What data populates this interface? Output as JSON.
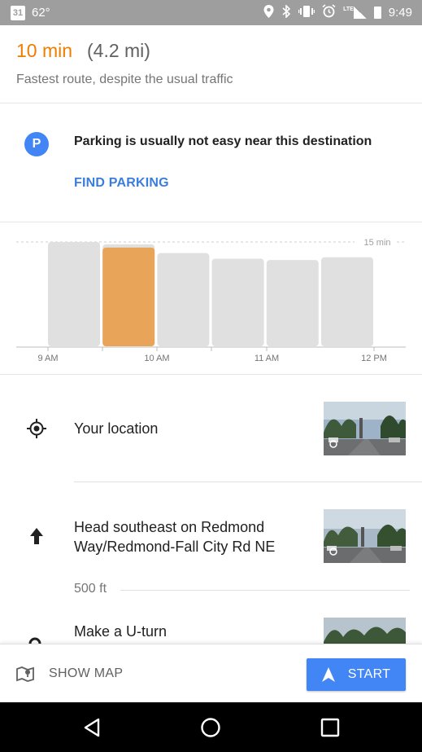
{
  "status_bar": {
    "calendar_day": "31",
    "temperature": "62°",
    "network": "LTE",
    "clock": "9:49",
    "icons": [
      "calendar-icon",
      "location-icon",
      "bluetooth-icon",
      "vibrate-icon",
      "alarm-icon",
      "signal-icon",
      "battery-icon"
    ]
  },
  "route": {
    "duration": "10 min",
    "distance": "(4.2 mi)",
    "summary": "Fastest route, despite the usual traffic"
  },
  "parking": {
    "icon_letter": "P",
    "message": "Parking is usually not easy near this destination",
    "action": "FIND PARKING"
  },
  "chart_data": {
    "type": "bar",
    "categories": [
      "9:00",
      "9:30",
      "10:00",
      "10:30",
      "11:00",
      "11:30"
    ],
    "values": [
      15,
      14.2,
      13.4,
      12.6,
      12.4,
      12.8
    ],
    "highlighted_index": 1,
    "highlight_color": "#e8a55a",
    "bar_color": "#e0e0e0",
    "reference_line_label": "15 min",
    "x_tick_labels": [
      "9 AM",
      "10 AM",
      "11 AM",
      "12 PM"
    ],
    "grid": false
  },
  "steps": {
    "origin": "Your location",
    "step1_text": "Head southeast on Redmond Way/Redmond-Fall City Rd NE",
    "step1_distance": "500 ft",
    "step2_text": "Make a U-turn"
  },
  "bottom_bar": {
    "show_map_label": "SHOW MAP",
    "start_label": "START"
  },
  "colors": {
    "accent": "#ef7d00",
    "link": "#3b7ddd",
    "primary": "#4285f4",
    "status_bar": "#9e9e9e"
  }
}
